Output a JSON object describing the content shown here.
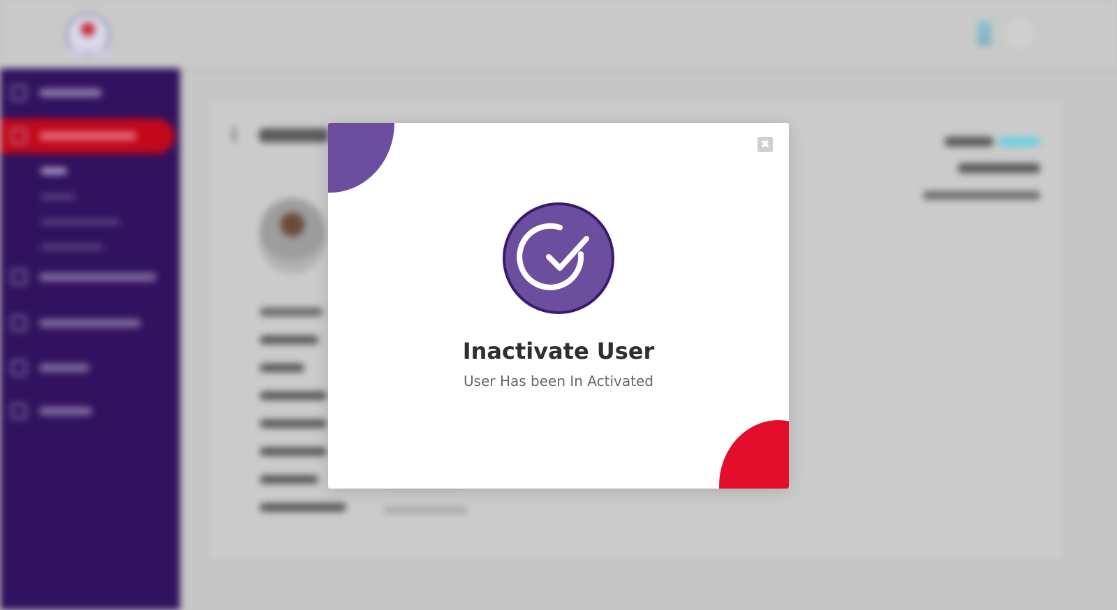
{
  "colors": {
    "sidebar_bg": "#31125e",
    "active_nav": "#c2081b",
    "modal_accent_purple": "#6b4e9e",
    "modal_accent_red": "#e20e2b",
    "check_badge": "#6b4e9e",
    "check_badge_border": "#3a1a6e"
  },
  "modal": {
    "title": "Inactivate User",
    "message": "User Has been In Activated",
    "close_label": "✖"
  }
}
